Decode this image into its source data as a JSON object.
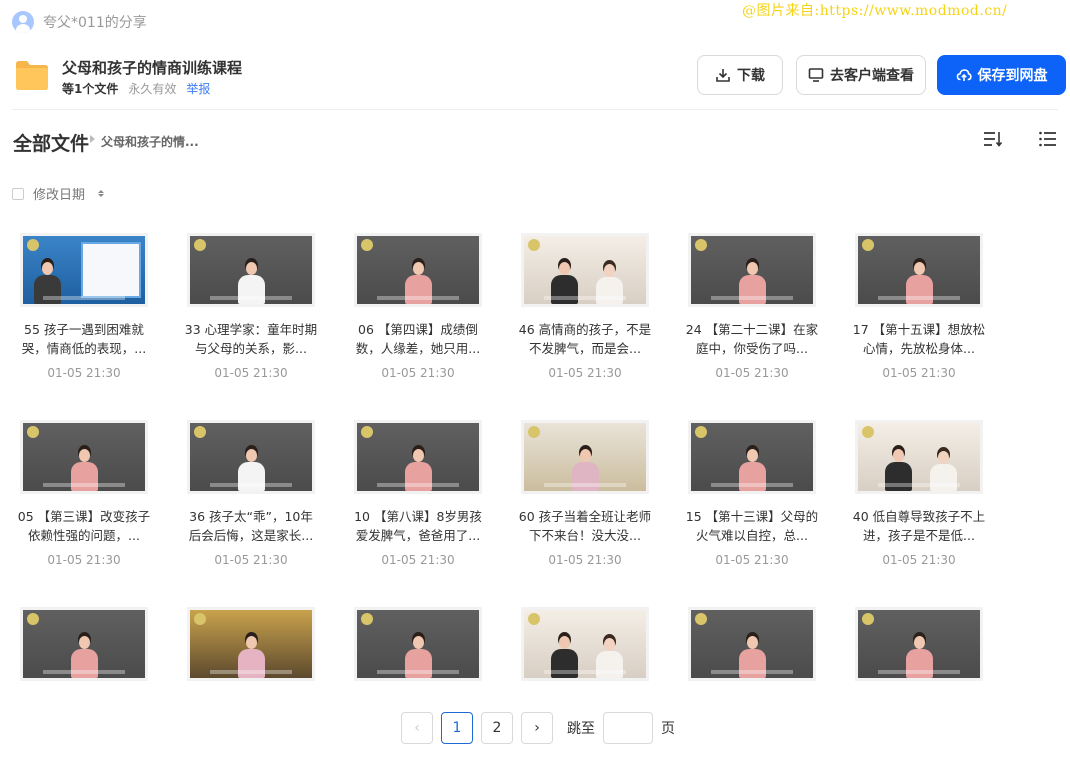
{
  "watermark": "@图片来自:https://www.modmod.cn/",
  "sharer": {
    "text": "夸父*011的分享"
  },
  "folder": {
    "title": "父母和孩子的情商训练课程",
    "count": "等1个文件",
    "validity": "永久有效",
    "report": "举报"
  },
  "actions": {
    "download": "下载",
    "client": "去客户端查看",
    "save": "保存到网盘"
  },
  "breadcrumb": {
    "root": "全部文件",
    "current": "父母和孩子的情..."
  },
  "sort": {
    "label": "修改日期"
  },
  "files": [
    {
      "title": "55 孩子一遇到困难就哭，情商低的表现，...",
      "date": "01-05 21:30",
      "style": "v-blue"
    },
    {
      "title": "33 心理学家：童年时期与父母的关系，影...",
      "date": "01-05 21:30",
      "style": "v-white"
    },
    {
      "title": "06 【第四课】成绩倒数，人缘差，她只用...",
      "date": "01-05 21:30",
      "style": "v-dark"
    },
    {
      "title": "46 高情商的孩子，不是不发脾气，而是会...",
      "date": "01-05 21:30",
      "style": "v-sofa"
    },
    {
      "title": "24 【第二十二课】在家庭中，你受伤了吗...",
      "date": "01-05 21:30",
      "style": "v-dark"
    },
    {
      "title": "17 【第十五课】想放松心情，先放松身体...",
      "date": "01-05 21:30",
      "style": "v-dark"
    },
    {
      "title": "05 【第三课】改变孩子依赖性强的问题，...",
      "date": "01-05 21:30",
      "style": "v-dark"
    },
    {
      "title": "36 孩子太“乖”，10年后会后悔，这是家长...",
      "date": "01-05 21:30",
      "style": "v-white"
    },
    {
      "title": "10 【第八课】8岁男孩爱发脾气，爸爸用了...",
      "date": "01-05 21:30",
      "style": "v-dark"
    },
    {
      "title": "60 孩子当着全班让老师下不来台！没大没...",
      "date": "01-05 21:30",
      "style": "v-yellow"
    },
    {
      "title": "15 【第十三课】父母的火气难以自控，总...",
      "date": "01-05 21:30",
      "style": "v-dark"
    },
    {
      "title": "40 低自尊导致孩子不上进，孩子是不是低...",
      "date": "01-05 21:30",
      "style": "v-sofa"
    },
    {
      "title": "",
      "date": "",
      "style": "v-dark"
    },
    {
      "title": "",
      "date": "",
      "style": "v-gold"
    },
    {
      "title": "",
      "date": "",
      "style": "v-dark"
    },
    {
      "title": "",
      "date": "",
      "style": "v-sofa"
    },
    {
      "title": "",
      "date": "",
      "style": "v-dark"
    },
    {
      "title": "",
      "date": "",
      "style": "v-dark"
    }
  ],
  "pagination": {
    "prev": "‹",
    "pages": [
      "1",
      "2"
    ],
    "current": "1",
    "next": "›",
    "jump_label": "跳至",
    "page_label": "页"
  }
}
